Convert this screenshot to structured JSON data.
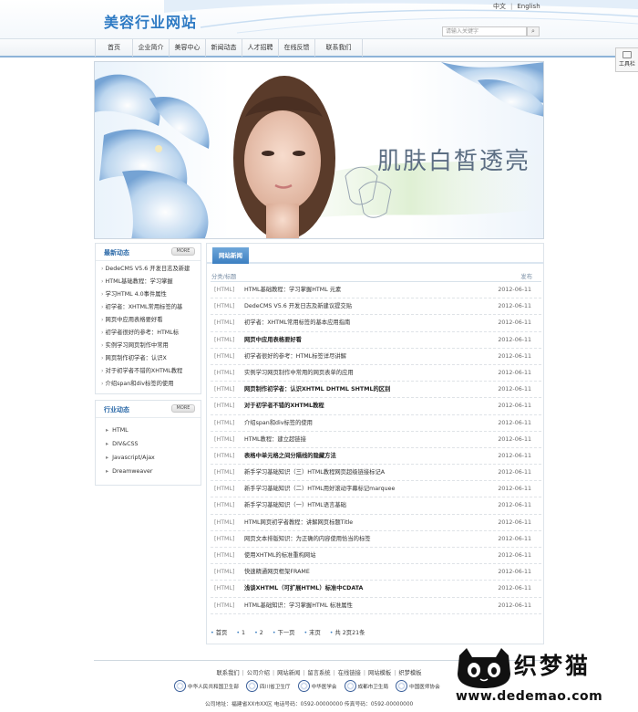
{
  "site": {
    "logo": "美容行业网站",
    "lang": [
      "中文",
      "English"
    ],
    "search_placeholder": "请输入关键字"
  },
  "nav": [
    "首页",
    "企业简介",
    "美容中心",
    "新闻动态",
    "人才招聘",
    "在线反馈",
    "联系我们"
  ],
  "toolbar_label": "工具栏",
  "banner_text": "肌肤白皙透亮",
  "sidebar": {
    "latest": {
      "title": "最新动态",
      "more": "MORE",
      "items": [
        "DedeCMS V5.6 开发日志及新建",
        "HTML基础教程：学习掌握",
        "学习HTML 4.0事件属性",
        "初学者：XHTML常用标签的基",
        "网页中应用表格要好看",
        "初学者很好的参考：HTML标",
        "实例学习网页制作中常用",
        "网页制作初学者：认识X",
        "对于初学者不错的XHTML教程",
        "介绍span和div标签的使用"
      ]
    },
    "industry": {
      "title": "行业动态",
      "more": "MORE",
      "items": [
        "HTML",
        "DIV&CSS",
        "Javascript/Ajax",
        "Dreamweaver"
      ]
    }
  },
  "main": {
    "tab": "网站新闻",
    "col_title": "分类/标题",
    "col_date": "发布",
    "rows": [
      {
        "cat": "[HTML]",
        "title": "HTML基础教程：学习掌握HTML 元素",
        "date": "2012-06-11",
        "bold": false
      },
      {
        "cat": "[HTML]",
        "title": "DedeCMS V5.6 开发日志及新建议提交贴",
        "date": "2012-06-11",
        "bold": false
      },
      {
        "cat": "[HTML]",
        "title": "初学者：XHTML常用标签的基本应用指南",
        "date": "2012-06-11",
        "bold": false
      },
      {
        "cat": "[HTML]",
        "title": "网页中应用表格要好看",
        "date": "2012-06-11",
        "bold": true
      },
      {
        "cat": "[HTML]",
        "title": "初学者很好的参考：HTML标签详尽讲解",
        "date": "2012-06-11",
        "bold": false
      },
      {
        "cat": "[HTML]",
        "title": "实例学习网页制作中常用的网页表单的应用",
        "date": "2012-06-11",
        "bold": false
      },
      {
        "cat": "[HTML]",
        "title": "网页制作初学者：认识XHTML DHTML SHTML的区别",
        "date": "2012-06-11",
        "bold": true
      },
      {
        "cat": "[HTML]",
        "title": "对于初学者不错的XHTML教程",
        "date": "2012-06-11",
        "bold": true
      },
      {
        "cat": "[HTML]",
        "title": "介绍span和div标签的使用",
        "date": "2012-06-11",
        "bold": false
      },
      {
        "cat": "[HTML]",
        "title": "HTML教程：建立超链接",
        "date": "2012-06-11",
        "bold": false
      },
      {
        "cat": "[HTML]",
        "title": "表格中单元格之间分隔线的隐藏方法",
        "date": "2012-06-11",
        "bold": true
      },
      {
        "cat": "[HTML]",
        "title": "新手学习基础知识（三）HTML教程网页超级链接标记A",
        "date": "2012-06-11",
        "bold": false
      },
      {
        "cat": "[HTML]",
        "title": "新手学习基础知识（二）HTML用好滚动字幕标记marquee",
        "date": "2012-06-11",
        "bold": false
      },
      {
        "cat": "[HTML]",
        "title": "新手学习基础知识（一）HTML语言基础",
        "date": "2012-06-11",
        "bold": false
      },
      {
        "cat": "[HTML]",
        "title": "HTML网页初学者教程：讲解网页标题Title",
        "date": "2012-06-11",
        "bold": false
      },
      {
        "cat": "[HTML]",
        "title": "网页文本排版知识：为正确的内容使用恰当的标签",
        "date": "2012-06-11",
        "bold": false
      },
      {
        "cat": "[HTML]",
        "title": "使用XHTML的标准重构网站",
        "date": "2012-06-11",
        "bold": false
      },
      {
        "cat": "[HTML]",
        "title": "快速精通网页框架FRAME",
        "date": "2012-06-11",
        "bold": false
      },
      {
        "cat": "[HTML]",
        "title": "浅谈XHTML（可扩展HTML）标准中CDATA",
        "date": "2012-06-11",
        "bold": true
      },
      {
        "cat": "[HTML]",
        "title": "HTML基础知识：学习掌握HTML 标准属性",
        "date": "2012-06-11",
        "bold": false
      }
    ],
    "pager": {
      "first": "首页",
      "p1": "1",
      "p2": "2",
      "next": "下一页",
      "last": "末页",
      "summary": "共 2页21条"
    }
  },
  "footer": {
    "links": [
      "联系我们",
      "公司介绍",
      "网站新闻",
      "留言系统",
      "在线链接",
      "网站模板",
      "织梦模板"
    ],
    "badges": [
      "中华人民共和国卫生部",
      "四川省卫生厅",
      "中华医学会",
      "成都市卫生局",
      "中国医师协会"
    ],
    "address": "公司地址：福建省XX市XX区   电话号码：0592-00000000   传真号码：0592-00000000"
  },
  "watermark": {
    "cn": "织梦猫",
    "url": "www.dedemao.com"
  }
}
